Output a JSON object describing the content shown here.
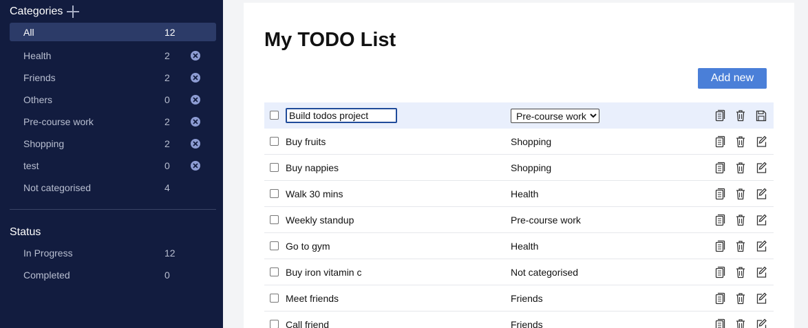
{
  "sidebar": {
    "categories_title": "Categories",
    "categories": [
      {
        "name": "All",
        "count": "12"
      },
      {
        "name": "Health",
        "count": "2"
      },
      {
        "name": "Friends",
        "count": "2"
      },
      {
        "name": "Others",
        "count": "0"
      },
      {
        "name": "Pre-course work",
        "count": "2"
      },
      {
        "name": "Shopping",
        "count": "2"
      },
      {
        "name": "test",
        "count": "0"
      },
      {
        "name": "Not categorised",
        "count": "4"
      }
    ],
    "status_title": "Status",
    "statuses": [
      {
        "name": "In Progress",
        "count": "12"
      },
      {
        "name": "Completed",
        "count": "0"
      }
    ]
  },
  "main": {
    "title": "My TODO List",
    "add_button": "Add new",
    "editing": {
      "text": "Build todos project",
      "category": "Pre-course work"
    },
    "todos": [
      {
        "text": "Buy fruits",
        "category": "Shopping"
      },
      {
        "text": "Buy nappies",
        "category": "Shopping"
      },
      {
        "text": "Walk 30 mins",
        "category": "Health"
      },
      {
        "text": "Weekly standup",
        "category": "Pre-course work"
      },
      {
        "text": "Go to gym",
        "category": "Health"
      },
      {
        "text": "Buy iron vitamin c",
        "category": "Not categorised"
      },
      {
        "text": "Meet friends",
        "category": "Friends"
      },
      {
        "text": "Call friend",
        "category": "Friends"
      }
    ]
  },
  "colors": {
    "sidebar_bg": "#121c3f",
    "sidebar_active": "#2c3b68",
    "accent": "#4a7fd8",
    "remove_icon": "#8d9cd3",
    "editing_row": "#e9effc"
  }
}
